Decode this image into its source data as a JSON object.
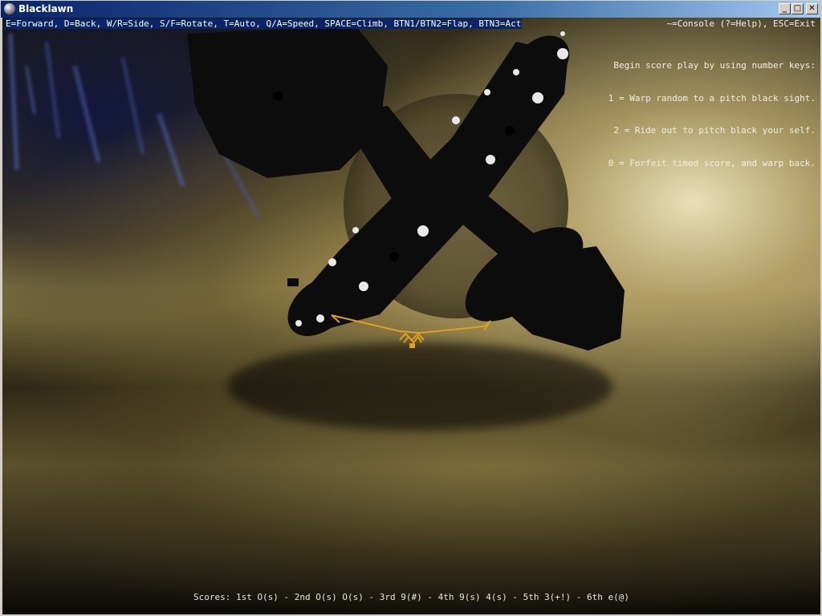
{
  "window": {
    "title": "Blacklawn",
    "min_glyph": "_",
    "max_glyph": "□",
    "close_glyph": "✕"
  },
  "hud": {
    "controls_hint": "E=Forward, D=Back, W/R=Side, S/F=Rotate, T=Auto, Q/A=Speed, SPACE=Climb, BTN1/BTN2=Flap, BTN3=Act",
    "console_hint": "~=Console (?=Help), ESC=Exit",
    "info_lines": [
      "Begin score play by using number keys:",
      "1 = Warp random to a pitch black sight.",
      "2 = Ride out to pitch black your self.",
      "0 = Forfeit timed score, and warp back."
    ],
    "scores": "Scores: 1st O(s) - 2nd O(s) O(s) - 3rd 9(#) - 4th 9(s) 4(s) - 5th 3(+!) - 6th e(@)"
  },
  "colors": {
    "titlebar_start": "#0a246a",
    "titlebar_end": "#a6caf0",
    "hud_text": "#ffffff",
    "aircraft": "#0c0c0c",
    "orb_lights": "#e8e8e8",
    "reticle": "#e0a020"
  },
  "icons": {
    "app": "globe-icon",
    "minimize": "minimize-icon",
    "maximize": "maximize-icon",
    "close": "close-icon"
  }
}
